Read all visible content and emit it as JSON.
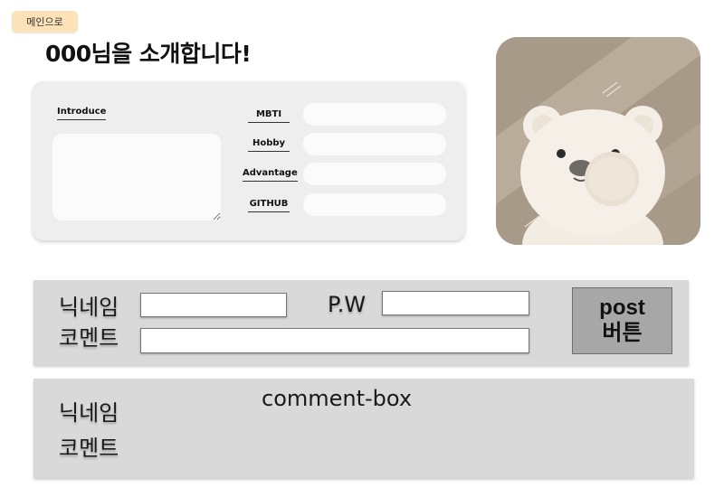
{
  "nav": {
    "main_button_label": "메인으로"
  },
  "title": "000님을 소개합니다!",
  "profile": {
    "introduce_label": "Introduce",
    "introduce_value": "",
    "fields": [
      {
        "label": "MBTI",
        "value": ""
      },
      {
        "label": "Hobby",
        "value": ""
      },
      {
        "label": "Advantage",
        "value": ""
      },
      {
        "label": "GITHUB",
        "value": ""
      }
    ],
    "photo_icon": "polar-bear-photo"
  },
  "form": {
    "nickname_label": "닉네임",
    "nickname_value": "",
    "password_label": "P.W",
    "password_value": "",
    "comment_label": "코멘트",
    "comment_value": "",
    "post_button_line1": "post",
    "post_button_line2": "버튼"
  },
  "comment_display": {
    "nickname_label": "닉네임",
    "comment_label": "코멘트",
    "box_label": "comment-box"
  },
  "colors": {
    "main_button": "#fde1b8",
    "card_bg": "#efeeee",
    "panel_bg": "#d9d9d9",
    "post_button": "#a7a7a7",
    "photo_bg": "#a89a88"
  }
}
